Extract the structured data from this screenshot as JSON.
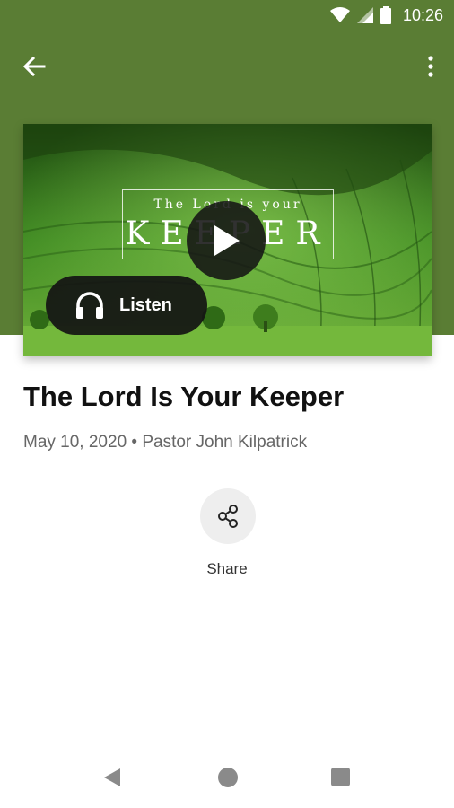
{
  "status_bar": {
    "time": "10:26",
    "icons": [
      "wifi-icon",
      "cellular-signal-icon",
      "battery-icon"
    ]
  },
  "app_bar": {
    "back_icon": "arrow-back-icon",
    "more_icon": "more-vert-icon"
  },
  "media": {
    "artwork_title_line1": "The Lord is your",
    "artwork_title_line2": "KEEPER",
    "play_icon": "play-icon",
    "listen_label": "Listen",
    "listen_icon": "headphones-icon"
  },
  "sermon": {
    "title": "The Lord Is Your Keeper",
    "meta": "May 10, 2020 • Pastor John Kilpatrick"
  },
  "share": {
    "label": "Share",
    "icon": "share-icon"
  },
  "navigation": {
    "back_icon": "nav-back-icon",
    "home_icon": "nav-home-icon",
    "recents_icon": "nav-recents-icon"
  },
  "colors": {
    "header_green": "#5a7d34",
    "field_green": "#3d8a1f",
    "button_dark": "#141414"
  }
}
